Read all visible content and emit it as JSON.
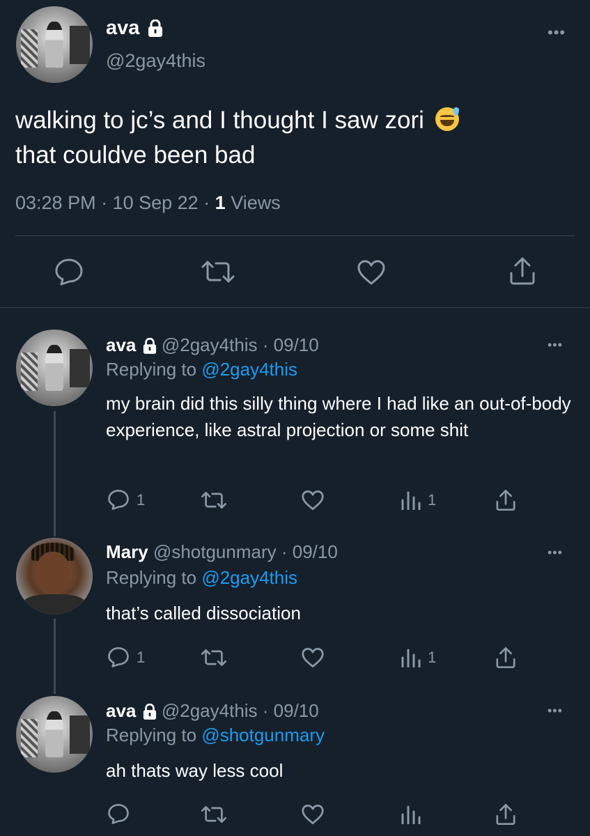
{
  "main_tweet": {
    "name": "ava",
    "handle": "@2gay4this",
    "text_line1": "walking to jc’s and I thought I saw zori",
    "emoji": "sweat-smile-emoji",
    "text_line2": "that couldve been bad",
    "time": "03:28 PM · 10 Sep 22 · ",
    "views_count": "1",
    "views_label": " Views",
    "more": "•••"
  },
  "replies": [
    {
      "name": "ava",
      "handle": "@2gay4this",
      "date": " · 09/10",
      "replying_label": "Replying to ",
      "replying_to": "@2gay4this",
      "text": "my brain did this silly thing where I had like an out-of-body experience, like astral projection or some shit",
      "reply_count": "1",
      "view_count": "1",
      "more": "•••"
    },
    {
      "name": "Mary",
      "handle": "@shotgunmary",
      "date": " · 09/10",
      "replying_label": "Replying to ",
      "replying_to": "@2gay4this",
      "text": "that’s called dissociation",
      "reply_count": "1",
      "view_count": "1",
      "more": "•••"
    },
    {
      "name": "ava",
      "handle": "@2gay4this",
      "date": " · 09/10",
      "replying_label": "Replying to ",
      "replying_to": "@shotgunmary",
      "text": "ah thats way less cool",
      "more": "•••"
    }
  ],
  "colors": {
    "background": "#15202b",
    "text": "#ffffff",
    "muted": "#8b98a5",
    "link": "#1d9bf0",
    "divider": "#38444d"
  }
}
